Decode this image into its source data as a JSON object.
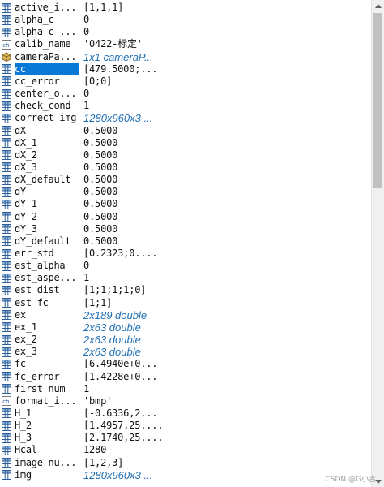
{
  "variables": [
    {
      "name": "active_i...",
      "value": "[1,1,1]",
      "kind": "grid",
      "italic": false
    },
    {
      "name": "alpha_c",
      "value": "0",
      "kind": "grid",
      "italic": false
    },
    {
      "name": "alpha_c_...",
      "value": "0",
      "kind": "grid",
      "italic": false
    },
    {
      "name": "calib_name",
      "value": "'0422-标定'",
      "kind": "char",
      "italic": false
    },
    {
      "name": "cameraPa...",
      "value": "1x1 cameraP...",
      "kind": "object",
      "italic": true
    },
    {
      "name": "cc",
      "value": "[479.5000;...",
      "kind": "grid",
      "italic": false,
      "selected": true
    },
    {
      "name": "cc_error",
      "value": "[0;0]",
      "kind": "grid",
      "italic": false
    },
    {
      "name": "center_o...",
      "value": "0",
      "kind": "grid",
      "italic": false
    },
    {
      "name": "check_cond",
      "value": "1",
      "kind": "grid",
      "italic": false
    },
    {
      "name": "correct_img",
      "value": "1280x960x3 ...",
      "kind": "grid",
      "italic": true
    },
    {
      "name": "dX",
      "value": "0.5000",
      "kind": "grid",
      "italic": false
    },
    {
      "name": "dX_1",
      "value": "0.5000",
      "kind": "grid",
      "italic": false
    },
    {
      "name": "dX_2",
      "value": "0.5000",
      "kind": "grid",
      "italic": false
    },
    {
      "name": "dX_3",
      "value": "0.5000",
      "kind": "grid",
      "italic": false
    },
    {
      "name": "dX_default",
      "value": "0.5000",
      "kind": "grid",
      "italic": false
    },
    {
      "name": "dY",
      "value": "0.5000",
      "kind": "grid",
      "italic": false
    },
    {
      "name": "dY_1",
      "value": "0.5000",
      "kind": "grid",
      "italic": false
    },
    {
      "name": "dY_2",
      "value": "0.5000",
      "kind": "grid",
      "italic": false
    },
    {
      "name": "dY_3",
      "value": "0.5000",
      "kind": "grid",
      "italic": false
    },
    {
      "name": "dY_default",
      "value": "0.5000",
      "kind": "grid",
      "italic": false
    },
    {
      "name": "err_std",
      "value": "[0.2323;0....",
      "kind": "grid",
      "italic": false
    },
    {
      "name": "est_alpha",
      "value": "0",
      "kind": "grid",
      "italic": false
    },
    {
      "name": "est_aspe...",
      "value": "1",
      "kind": "grid",
      "italic": false
    },
    {
      "name": "est_dist",
      "value": "[1;1;1;1;0]",
      "kind": "grid",
      "italic": false
    },
    {
      "name": "est_fc",
      "value": "[1;1]",
      "kind": "grid",
      "italic": false
    },
    {
      "name": "ex",
      "value": "2x189 double",
      "kind": "grid",
      "italic": true
    },
    {
      "name": "ex_1",
      "value": "2x63 double",
      "kind": "grid",
      "italic": true
    },
    {
      "name": "ex_2",
      "value": "2x63 double",
      "kind": "grid",
      "italic": true
    },
    {
      "name": "ex_3",
      "value": "2x63 double",
      "kind": "grid",
      "italic": true
    },
    {
      "name": "fc",
      "value": "[6.4940e+0...",
      "kind": "grid",
      "italic": false
    },
    {
      "name": "fc_error",
      "value": "[1.4228e+0...",
      "kind": "grid",
      "italic": false
    },
    {
      "name": "first_num",
      "value": "1",
      "kind": "grid",
      "italic": false
    },
    {
      "name": "format_i...",
      "value": "'bmp'",
      "kind": "char",
      "italic": false
    },
    {
      "name": "H_1",
      "value": "[-0.6336,2...",
      "kind": "grid",
      "italic": false
    },
    {
      "name": "H_2",
      "value": "[1.4957,25....",
      "kind": "grid",
      "italic": false
    },
    {
      "name": "H_3",
      "value": "[2.1740,25....",
      "kind": "grid",
      "italic": false
    },
    {
      "name": "Hcal",
      "value": "1280",
      "kind": "grid",
      "italic": false
    },
    {
      "name": "image_nu...",
      "value": "[1,2,3]",
      "kind": "grid",
      "italic": false
    },
    {
      "name": "img",
      "value": "1280x960x3 ...",
      "kind": "grid",
      "italic": true
    }
  ],
  "watermark": "CSDN @G小吉",
  "colors": {
    "selection": "#0a78d7",
    "italic_value": "#1f6fb5",
    "grid_icon_border": "#2e5f9a",
    "grid_icon_header": "#8fb3dd"
  }
}
